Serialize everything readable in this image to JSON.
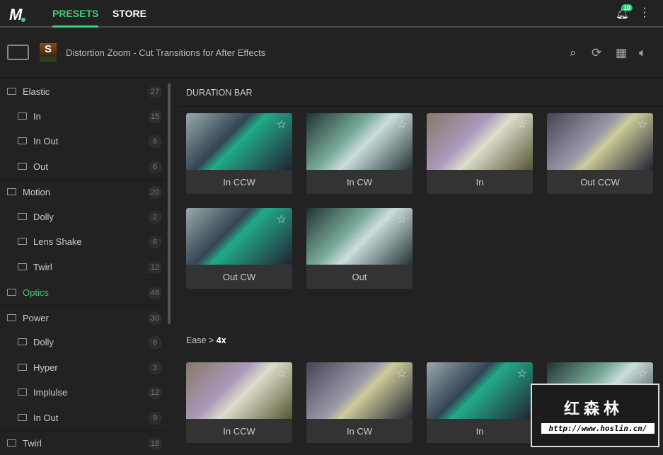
{
  "topbar": {
    "logo": "M",
    "tabs": [
      {
        "label": "PRESETS",
        "active": true
      },
      {
        "label": "STORE",
        "active": false
      }
    ],
    "notifications": "10"
  },
  "header": {
    "title": "Distortion Zoom - Cut Transitions for After Effects",
    "thumb_letter": "S",
    "icons": [
      "search-icon",
      "preview-loop-icon",
      "grid-view-icon",
      "volume-icon"
    ]
  },
  "sidebar": [
    {
      "label": "Elastic",
      "count": "27",
      "level": 0
    },
    {
      "label": "In",
      "count": "15",
      "level": 1
    },
    {
      "label": "In Out",
      "count": "6",
      "level": 1
    },
    {
      "label": "Out",
      "count": "6",
      "level": 1
    },
    {
      "label": "Motion",
      "count": "20",
      "level": 0
    },
    {
      "label": "Dolly",
      "count": "2",
      "level": 1
    },
    {
      "label": "Lens Shake",
      "count": "6",
      "level": 1
    },
    {
      "label": "Twirl",
      "count": "12",
      "level": 1
    },
    {
      "label": "Optics",
      "count": "46",
      "level": 0,
      "active": true
    },
    {
      "label": "Power",
      "count": "30",
      "level": 0
    },
    {
      "label": "Dolly",
      "count": "6",
      "level": 1
    },
    {
      "label": "Hyper",
      "count": "3",
      "level": 1
    },
    {
      "label": "Implulse",
      "count": "12",
      "level": 1
    },
    {
      "label": "In Out",
      "count": "9",
      "level": 1
    },
    {
      "label": "Twirl",
      "count": "18",
      "level": 0
    }
  ],
  "sections": [
    {
      "title": "DURATION BAR",
      "items": [
        "In CCW",
        "In CW",
        "In",
        "Out CCW",
        "Out CW",
        "Out"
      ]
    },
    {
      "title_prefix": "Ease > ",
      "title_bold": "4x",
      "items": [
        "In CCW",
        "In CW",
        "In",
        ""
      ]
    }
  ],
  "accent": "#3ecf7a",
  "watermark": {
    "text": "红森林",
    "url": "http://www.hoslin.cn/"
  }
}
